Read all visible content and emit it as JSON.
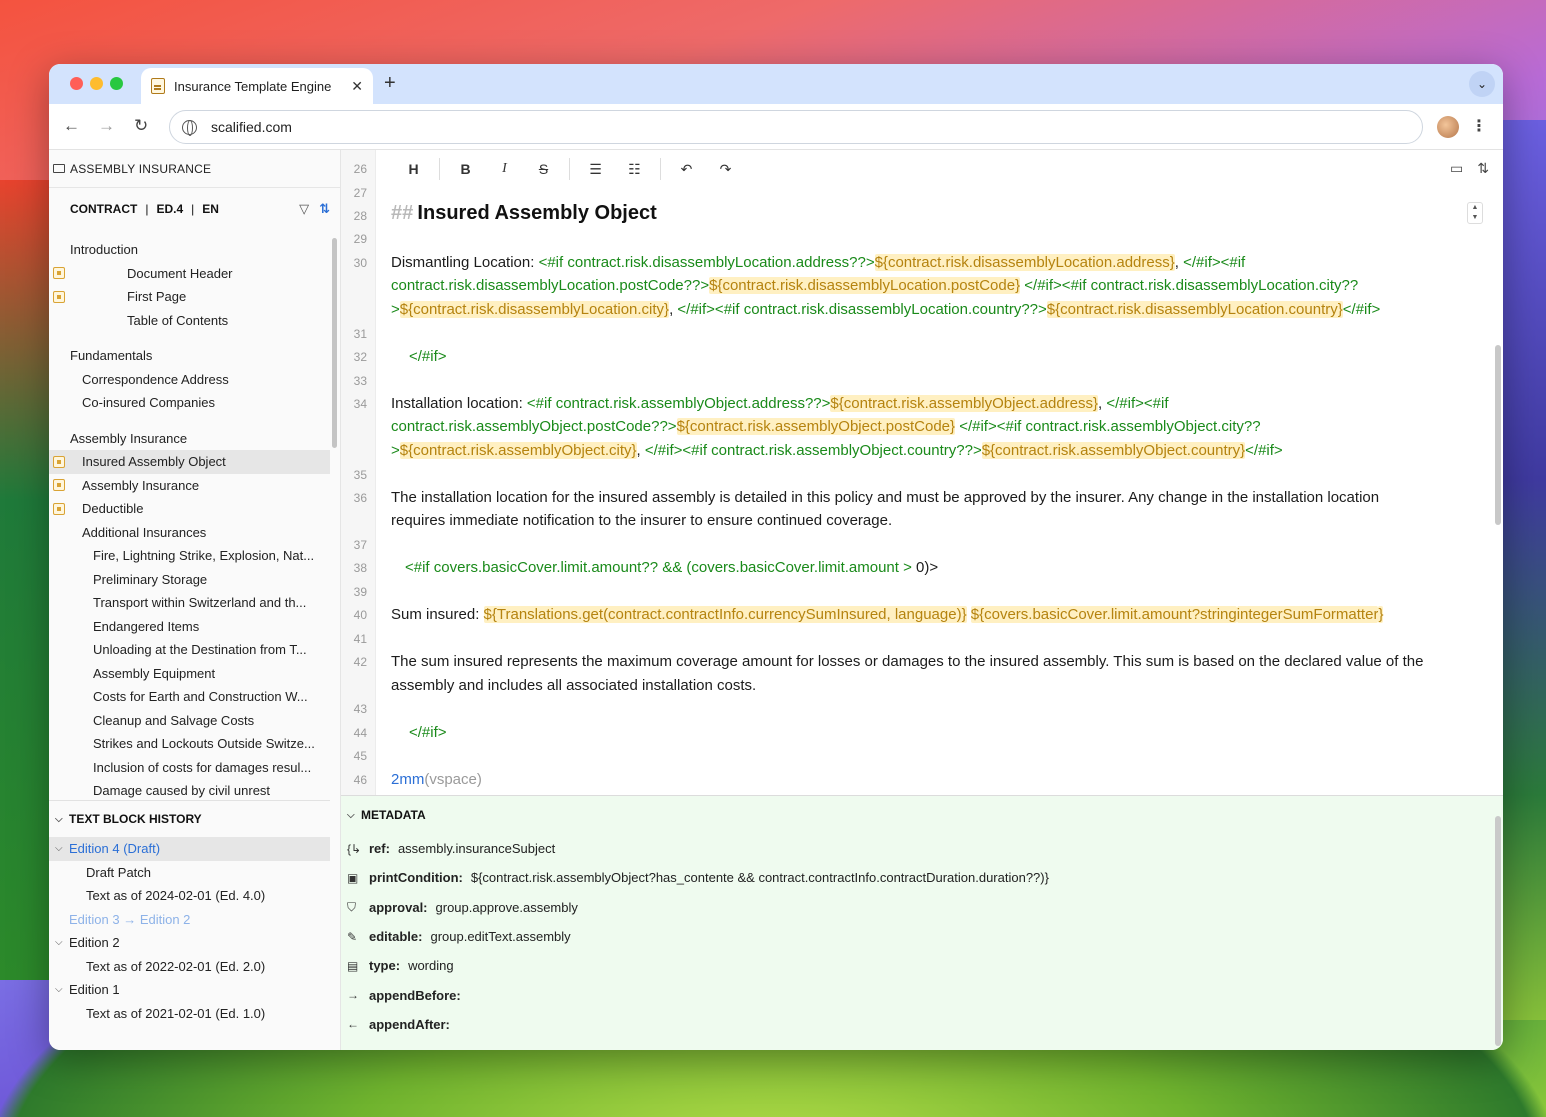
{
  "browser": {
    "tab_title": "Insurance Template Engine",
    "tab_close": "✕",
    "new_tab": "+",
    "url": "scalified.com"
  },
  "sidebar": {
    "title": "ASSEMBLY INSURANCE",
    "crumb": {
      "contract": "CONTRACT",
      "edition": "ED.4",
      "lang": "EN",
      "sep": "|"
    },
    "tree": [
      {
        "label": "Introduction",
        "indent": 0,
        "mark": false,
        "selected": false
      },
      {
        "label": "Document Header",
        "indent": 3,
        "mark": true,
        "selected": false
      },
      {
        "label": "First Page",
        "indent": 3,
        "mark": true,
        "selected": false
      },
      {
        "label": "Table of Contents",
        "indent": 3,
        "mark": false,
        "selected": false
      },
      {
        "gap": true
      },
      {
        "label": "Fundamentals",
        "indent": 0,
        "mark": false,
        "selected": false
      },
      {
        "label": "Correspondence Address",
        "indent": 1,
        "mark": false,
        "selected": false
      },
      {
        "label": "Co-insured Companies",
        "indent": 1,
        "mark": false,
        "selected": false
      },
      {
        "gap": true
      },
      {
        "label": "Assembly Insurance",
        "indent": 0,
        "mark": false,
        "selected": false
      },
      {
        "label": "Insured Assembly Object",
        "indent": 1,
        "mark": true,
        "selected": true
      },
      {
        "label": "Assembly Insurance",
        "indent": 1,
        "mark": true,
        "selected": false
      },
      {
        "label": "Deductible",
        "indent": 1,
        "mark": true,
        "selected": false
      },
      {
        "label": "Additional Insurances",
        "indent": 1,
        "mark": false,
        "selected": false
      },
      {
        "label": "Fire, Lightning Strike, Explosion, Nat...",
        "indent": 2,
        "mark": false,
        "selected": false
      },
      {
        "label": "Preliminary Storage",
        "indent": 2,
        "mark": false,
        "selected": false
      },
      {
        "label": "Transport within Switzerland and th...",
        "indent": 2,
        "mark": false,
        "selected": false
      },
      {
        "label": "Endangered Items",
        "indent": 2,
        "mark": false,
        "selected": false
      },
      {
        "label": "Unloading at the Destination from T...",
        "indent": 2,
        "mark": false,
        "selected": false
      },
      {
        "label": "Assembly Equipment",
        "indent": 2,
        "mark": false,
        "selected": false
      },
      {
        "label": "Costs for Earth and Construction W...",
        "indent": 2,
        "mark": false,
        "selected": false
      },
      {
        "label": "Cleanup and Salvage Costs",
        "indent": 2,
        "mark": false,
        "selected": false
      },
      {
        "label": "Strikes and Lockouts Outside Switze...",
        "indent": 2,
        "mark": false,
        "selected": false
      },
      {
        "label": "Inclusion of costs for damages resul...",
        "indent": 2,
        "mark": false,
        "selected": false
      },
      {
        "label": "Damage caused by civil unrest",
        "indent": 2,
        "mark": false,
        "selected": false
      }
    ]
  },
  "history": {
    "title": "TEXT BLOCK HISTORY",
    "items": [
      {
        "label": "Edition 4 (Draft)",
        "indent": 0,
        "chev": "⌵",
        "style": "blue",
        "selected": true
      },
      {
        "label": "Draft Patch",
        "indent": 1,
        "chev": "",
        "style": "",
        "selected": false
      },
      {
        "label": "Text as of 2024-02-01 (Ed. 4.0)",
        "indent": 1,
        "chev": "",
        "style": "",
        "selected": false
      },
      {
        "label": "Edition 3 → Edition 2",
        "indent": 0,
        "chev": "",
        "style": "faint",
        "selected": false
      },
      {
        "label": "Edition 2",
        "indent": 0,
        "chev": "⌵",
        "style": "",
        "selected": false
      },
      {
        "label": "Text as of 2022-02-01 (Ed. 2.0)",
        "indent": 1,
        "chev": "",
        "style": "",
        "selected": false
      },
      {
        "label": "Edition 1",
        "indent": 0,
        "chev": "⌵",
        "style": "",
        "selected": false
      },
      {
        "label": "Text as of 2021-02-01 (Ed. 1.0)",
        "indent": 1,
        "chev": "",
        "style": "",
        "selected": false
      }
    ]
  },
  "editor": {
    "toolbar": [
      "H",
      "B",
      "I",
      "S",
      "bullet-list",
      "ordered-list",
      "undo",
      "redo"
    ],
    "line_numbers": [
      26,
      27,
      28,
      29,
      30,
      31,
      32,
      33,
      34,
      35,
      36,
      37,
      38,
      39,
      40,
      41,
      42,
      43,
      44,
      45,
      46
    ],
    "heading_mark": "##",
    "heading": "Insured Assembly Object",
    "dismantling_label": "Dismantling Location: ",
    "dismantling": [
      [
        [
          "kw",
          "<#if contract.risk.disassemblyLocation.address??>"
        ],
        [
          "hl",
          "${contract.risk.disassemblyLocation.address}"
        ],
        [
          "t",
          ", "
        ],
        [
          "kw",
          "</#if><#if"
        ]
      ],
      [
        [
          "kw",
          "contract.risk.disassemblyLocation.postCode??>"
        ],
        [
          "hl",
          "${contract.risk.disassemblyLocation.postCode}"
        ],
        [
          "t",
          " "
        ],
        [
          "kw",
          "</#if><#if contract.risk.disassemblyLocation.city??"
        ]
      ],
      [
        [
          "kw",
          ">"
        ],
        [
          "hl",
          "${contract.risk.disassemblyLocation.city}"
        ],
        [
          "t",
          ", "
        ],
        [
          "kw",
          "</#if><#if contract.risk.disassemblyLocation.country??>"
        ],
        [
          "hl",
          "${contract.risk.disassemblyLocation.country}"
        ],
        [
          "kw",
          "</#if>"
        ]
      ]
    ],
    "endif": "</#if>",
    "installation_label": "Installation location: ",
    "installation": [
      [
        [
          "kw",
          "<#if contract.risk.assemblyObject.address??>"
        ],
        [
          "hl",
          "${contract.risk.assemblyObject.address}"
        ],
        [
          "t",
          ", "
        ],
        [
          "kw",
          "</#if><#if"
        ]
      ],
      [
        [
          "kw",
          "contract.risk.assemblyObject.postCode??>"
        ],
        [
          "hl",
          "${contract.risk.assemblyObject.postCode}"
        ],
        [
          "t",
          " "
        ],
        [
          "kw",
          "</#if><#if contract.risk.assemblyObject.city??"
        ]
      ],
      [
        [
          "kw",
          ">"
        ],
        [
          "hl",
          "${contract.risk.assemblyObject.city}"
        ],
        [
          "t",
          ", "
        ],
        [
          "kw",
          "</#if><#if contract.risk.assemblyObject.country??>"
        ],
        [
          "hl",
          "${contract.risk.assemblyObject.country}"
        ],
        [
          "kw",
          "</#if>"
        ]
      ]
    ],
    "installation_para_1": "The installation location for the insured assembly is detailed in this policy and must be approved by the insurer. Any change in the installation location",
    "installation_para_2": "requires immediate notification to the insurer to ensure continued coverage.",
    "if_covers": "<#if covers.basicCover.limit.amount?? && (covers.basicCover.limit.amount > ",
    "if_covers_tail": "0)>",
    "sum_label": "Sum insured: ",
    "sum_expr_1": "${Translations.get(contract.contractInfo.currencySumInsured, language)}",
    "sum_expr_2": "${covers.basicCover.limit.amount?string",
    "sum_expr_3": "integerSumFormatter",
    "sum_expr_4": "}",
    "sum_para_1": "The sum insured represents the maximum coverage amount for losses or damages to the insured assembly. This sum is based on the declared value of the",
    "sum_para_2": "assembly and includes all associated installation costs.",
    "vspace_val": "2mm",
    "vspace_name": "(vspace)"
  },
  "metadata": {
    "title": "METADATA",
    "rows": [
      {
        "icon": "ref-icon",
        "glyph": "{↳",
        "key": "ref:",
        "value": "assembly.insuranceSubject"
      },
      {
        "icon": "print-condition-icon",
        "glyph": "▣",
        "key": "printCondition:",
        "value": "${contract.risk.assemblyObject?has_contente && contract.contractInfo.contractDuration.duration??)}"
      },
      {
        "icon": "shield-icon",
        "glyph": "⛉",
        "key": "approval:",
        "value": "group.approve.assembly"
      },
      {
        "icon": "pencil-icon",
        "glyph": "✎",
        "key": "editable:",
        "value": "group.editText.assembly"
      },
      {
        "icon": "type-icon",
        "glyph": "▤",
        "key": "type:",
        "value": "wording"
      },
      {
        "icon": "arrow-right-icon",
        "glyph": "→",
        "key": "appendBefore:",
        "value": ""
      },
      {
        "icon": "arrow-left-icon",
        "glyph": "←",
        "key": "appendAfter:",
        "value": ""
      }
    ]
  }
}
